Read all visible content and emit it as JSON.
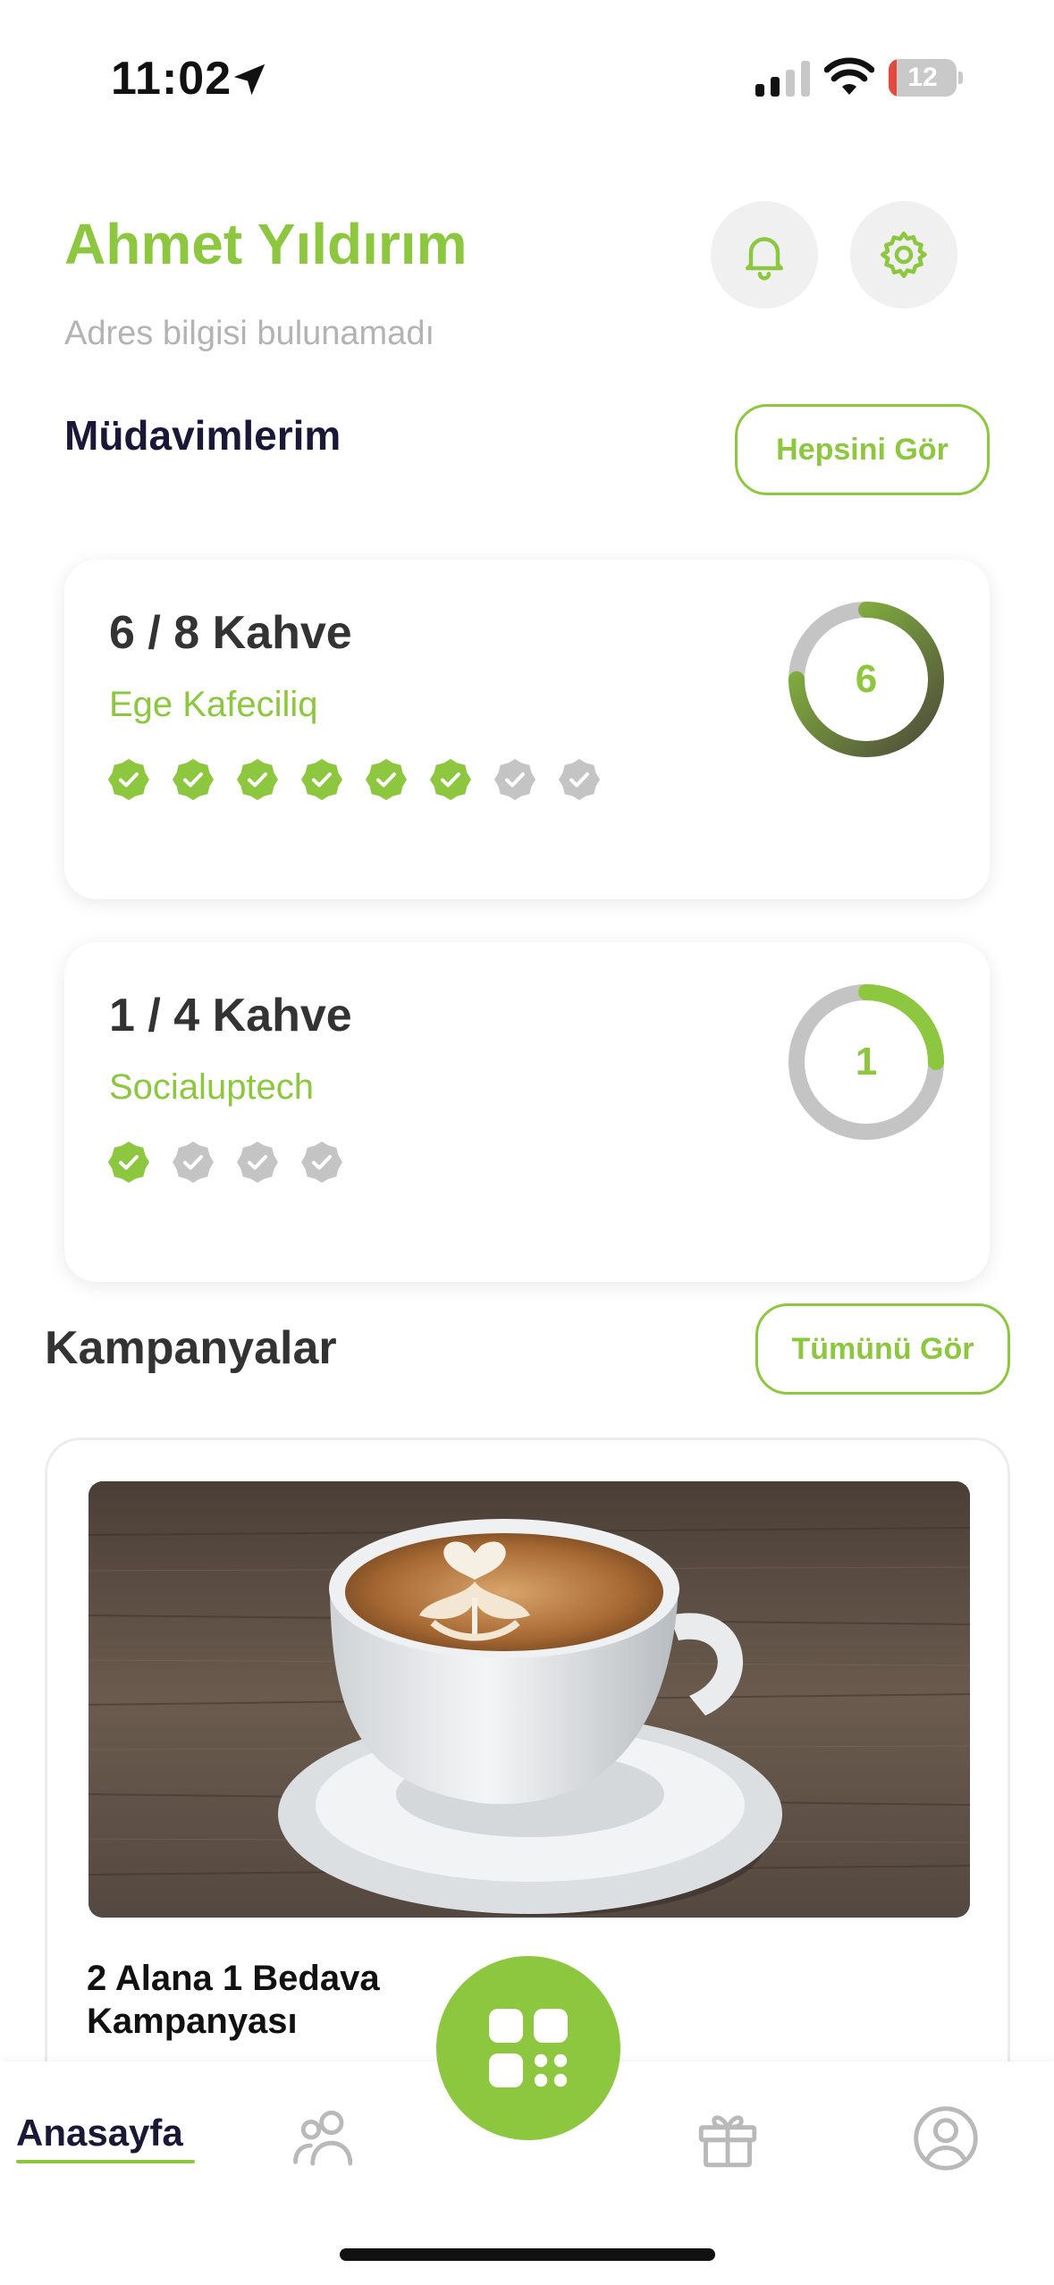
{
  "status_bar": {
    "time": "11:02",
    "battery_level": "12",
    "battery_fraction": 0.12,
    "icons": [
      "location-arrow-icon",
      "cellular-signal-icon",
      "wifi-icon",
      "battery-icon"
    ]
  },
  "header": {
    "user_name": "Ahmet Yıldırım",
    "address": "Adres bilgisi bulunamadı",
    "icons": [
      "bell-icon",
      "gear-icon"
    ]
  },
  "regulars": {
    "title": "Müdavimlerim",
    "see_all_label": "Hepsini Gör",
    "cards": [
      {
        "count_label": "6 / 8 Kahve",
        "shop": "Ege Kafeciliq",
        "stamped": 6,
        "total": 8,
        "ring_value": "6"
      },
      {
        "count_label": "1 / 4 Kahve",
        "shop": "Socialuptech",
        "stamped": 1,
        "total": 4,
        "ring_value": "1"
      }
    ]
  },
  "campaigns": {
    "title": "Kampanyalar",
    "see_all_label": "Tümünü Gör",
    "items": [
      {
        "title": "2 Alana 1 Bedava Kampanyası",
        "image": "latte-art-coffee-cup"
      }
    ]
  },
  "bottom_nav": {
    "home_label": "Anasayfa",
    "icons": [
      "people-icon",
      "qr-code-icon",
      "gift-icon",
      "profile-icon"
    ]
  },
  "colors": {
    "accent": "#8dc63f",
    "dark_text": "#1a1836",
    "muted": "#b3b3b3",
    "stamp_off": "#c4c4c4",
    "battery_low": "#e34a3f"
  }
}
